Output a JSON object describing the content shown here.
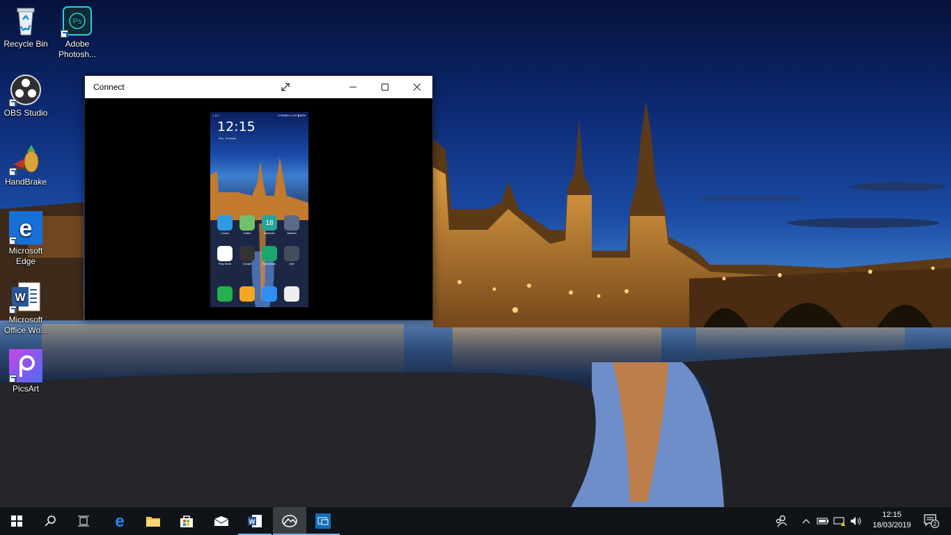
{
  "desktop": {
    "icons": [
      {
        "label": "Recycle Bin",
        "icon": "recycle-bin-icon"
      },
      {
        "label": "Adobe Photosh...",
        "icon": "photoshop-icon"
      },
      {
        "label": "OBS Studio",
        "icon": "obs-icon"
      },
      {
        "label": "HandBrake",
        "icon": "handbrake-icon"
      },
      {
        "label": "Microsoft Edge",
        "icon": "edge-icon"
      },
      {
        "label": "Microsoft Office Wo...",
        "icon": "word-icon"
      },
      {
        "label": "PicsArt",
        "icon": "picsart-icon"
      }
    ]
  },
  "window": {
    "title": "Connect",
    "buttons": [
      "expand-icon",
      "minimize-icon",
      "maximize-icon",
      "close-icon"
    ]
  },
  "phone": {
    "status_left": "• ◎ ⌂",
    "status_right": "0,00KB/d  ⊿  4G  ▮  86%",
    "time": "12:15",
    "date": "Sen, 18 Maret",
    "apps_row1": [
      "Cuaca",
      "Galeri",
      "Kalender",
      "Setelan"
    ],
    "apps_row2": [
      "Play Store",
      "Google",
      "Keamanan",
      "Alat"
    ],
    "calendar_day": "18"
  },
  "taskbar": {
    "pinned": [
      "start-icon",
      "search-icon",
      "task-view-icon",
      "edge-icon",
      "file-explorer-icon",
      "store-icon",
      "mail-icon",
      "word-icon",
      "photos-icon",
      "connect-icon"
    ],
    "time": "12:15",
    "date": "18/03/2019",
    "notifications": "2"
  },
  "colors": {
    "taskbar": "#101418",
    "accent": "#0078d7"
  }
}
